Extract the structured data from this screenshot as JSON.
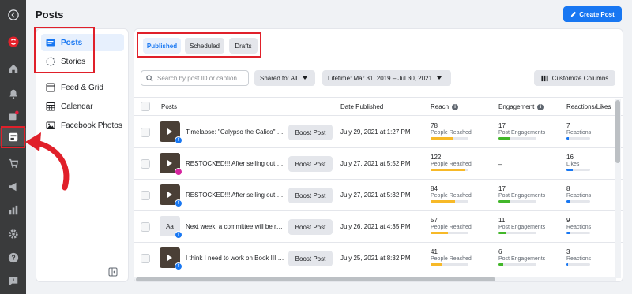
{
  "header": {
    "title": "Posts",
    "create_label": "Create Post"
  },
  "rail": {
    "icons": [
      "logo-icon",
      "home-icon",
      "bell-icon",
      "flag-icon",
      "content-icon",
      "shop-icon",
      "megaphone-icon",
      "chart-icon",
      "gear-icon",
      "help-icon",
      "report-icon"
    ]
  },
  "nav": {
    "items": [
      {
        "label": "Posts",
        "icon": "posts-icon",
        "active": true
      },
      {
        "label": "Stories",
        "icon": "stories-icon",
        "active": false
      },
      {
        "label": "Feed & Grid",
        "icon": "feed-icon",
        "active": false
      },
      {
        "label": "Calendar",
        "icon": "calendar-icon",
        "active": false
      },
      {
        "label": "Facebook Photos",
        "icon": "photos-icon",
        "active": false
      }
    ]
  },
  "tabs": [
    {
      "label": "Published",
      "active": true
    },
    {
      "label": "Scheduled",
      "active": false
    },
    {
      "label": "Drafts",
      "active": false
    }
  ],
  "filters": {
    "search_placeholder": "Search by post ID or caption",
    "shared_to": "Shared to: All",
    "lifetime": "Lifetime: Mar 31, 2019 – Jul 30, 2021",
    "customize": "Customize Columns"
  },
  "columns": {
    "posts": "Posts",
    "date": "Date Published",
    "reach": "Reach",
    "engagement": "Engagement",
    "reactions": "Reactions/Likes"
  },
  "boost_label": "Boost Post",
  "rows": [
    {
      "thumb": "video",
      "platform": "facebook",
      "caption": "Timelapse: \"Calypso the Calico\" ©...",
      "date": "July 29, 2021 at 1:27 PM",
      "reach": "78",
      "reach_label": "People Reached",
      "reach_pct": 0.6,
      "engagement": "17",
      "engagement_label": "Post Engagements",
      "engagement_pct": 0.3,
      "reactions": "7",
      "reactions_label": "Reactions",
      "reactions_pct": 0.1
    },
    {
      "thumb": "video",
      "platform": "instagram",
      "caption": "RESTOCKED!!! After selling out of ...",
      "date": "July 27, 2021 at 5:52 PM",
      "reach": "122",
      "reach_label": "People Reached",
      "reach_pct": 0.9,
      "engagement": "–",
      "engagement_label": "",
      "engagement_pct": 0,
      "reactions": "16",
      "reactions_label": "Likes",
      "reactions_pct": 0.25
    },
    {
      "thumb": "video",
      "platform": "facebook",
      "caption": "RESTOCKED!!! After selling out of ...",
      "date": "July 27, 2021 at 5:32 PM",
      "reach": "84",
      "reach_label": "People Reached",
      "reach_pct": 0.65,
      "engagement": "17",
      "engagement_label": "Post Engagements",
      "engagement_pct": 0.3,
      "reactions": "8",
      "reactions_label": "Reactions",
      "reactions_pct": 0.12
    },
    {
      "thumb": "text",
      "thumb_text": "Aa",
      "platform": "facebook",
      "caption": "Next week, a committee will be re...",
      "date": "July 26, 2021 at 4:35 PM",
      "reach": "57",
      "reach_label": "People Reached",
      "reach_pct": 0.45,
      "engagement": "11",
      "engagement_label": "Post Engagements",
      "engagement_pct": 0.2,
      "reactions": "9",
      "reactions_label": "Reactions",
      "reactions_pct": 0.13
    },
    {
      "thumb": "video",
      "platform": "facebook",
      "caption": "I think I need to work on Book III t...",
      "date": "July 25, 2021 at 8:32 PM",
      "reach": "41",
      "reach_label": "People Reached",
      "reach_pct": 0.32,
      "engagement": "6",
      "engagement_label": "Post Engagements",
      "engagement_pct": 0.12,
      "reactions": "3",
      "reactions_label": "Reactions",
      "reactions_pct": 0.05
    }
  ],
  "colors": {
    "accent": "#1877f2",
    "highlight": "#e0202a",
    "rail": "#3a3b3c"
  }
}
